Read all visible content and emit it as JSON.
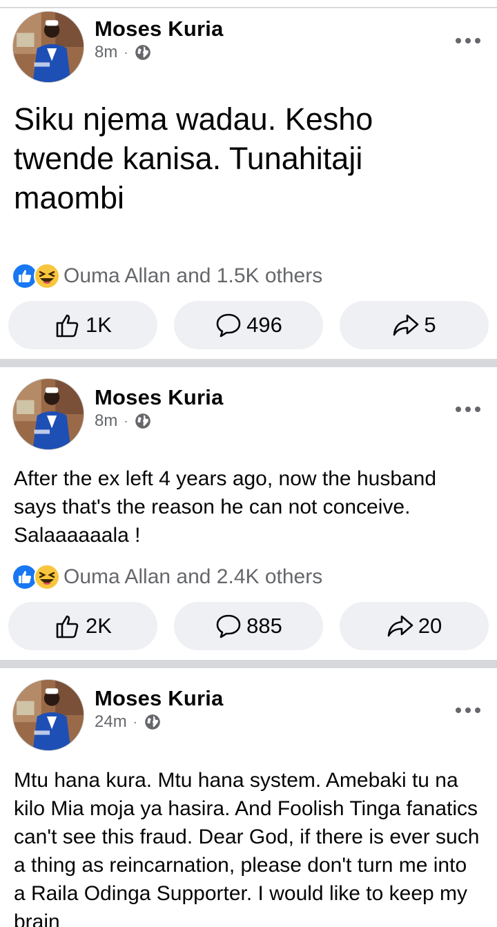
{
  "posts": [
    {
      "author": "Moses Kuria",
      "time": "8m",
      "text": "Siku njema wadau. Kesho twende kanisa. Tunahitaji maombi",
      "reactions_text": "Ouma Allan and 1.5K others",
      "likes": "1K",
      "comments": "496",
      "shares": "5"
    },
    {
      "author": "Moses Kuria",
      "time": "8m",
      "text": "After the ex left 4 years ago, now the husband says that's the reason he can not conceive. Salaaaaaala !",
      "reactions_text": "Ouma Allan and 2.4K others",
      "likes": "2K",
      "comments": "885",
      "shares": "20"
    },
    {
      "author": "Moses Kuria",
      "time": "24m",
      "text": "Mtu hana kura. Mtu hana system. Amebaki tu na kilo Mia moja ya hasira. And Foolish Tinga fanatics can't see this fraud. Dear God, if there is ever such a thing as reincarnation, please don't turn me into a Raila Odinga Supporter. I would like to keep my brain"
    }
  ],
  "meta_separator": "·",
  "icons": {
    "privacy": "globe-icon",
    "more": "more-options-icon",
    "like": "thumbs-up-icon",
    "comment": "comment-bubble-icon",
    "share": "share-arrow-icon",
    "reaction_like": "like-reaction-icon",
    "reaction_haha": "haha-reaction-icon"
  },
  "colors": {
    "like_blue": "#1877f2",
    "secondary_text": "#65676b",
    "button_bg": "#eef0f3",
    "divider": "#d6d8dc"
  }
}
